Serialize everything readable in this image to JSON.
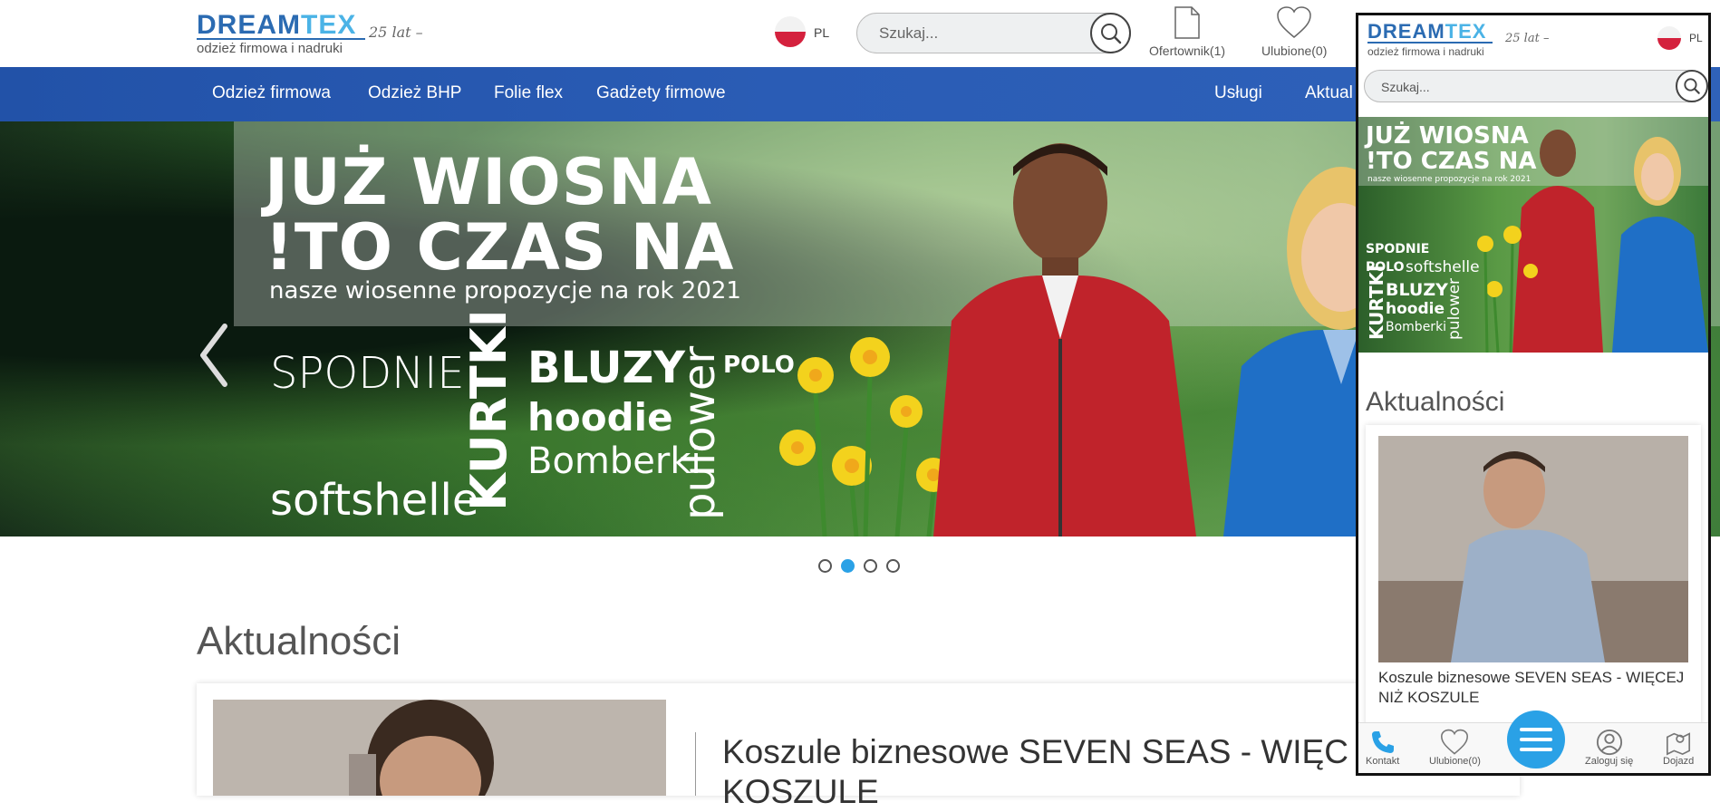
{
  "brand": {
    "logo_word_1": "DREAM",
    "logo_word_2": "TEX",
    "logo_tagline": "odzież firmowa i nadruki",
    "logo_years": "25 lat –"
  },
  "header": {
    "language": "PL",
    "search_placeholder": "Szukaj...",
    "offer_label": "Ofertownik(1)",
    "favorites_label": "Ulubione(0)"
  },
  "nav": {
    "items": [
      "Odzież firmowa",
      "Odzież BHP",
      "Folie flex",
      "Gadżety firmowe"
    ],
    "right_items": [
      "Usługi",
      "Aktual"
    ]
  },
  "hero": {
    "line1": "JUŻ WIOSNA",
    "line2": "!TO CZAS NA",
    "subtitle": "nasze wiosenne propozycje na rok 2021",
    "spodnie": "SPODNIE",
    "softshelle": "softshelle",
    "kurtki": "KURTKI",
    "bluzy": "BLUZY",
    "hoodie": "hoodie",
    "bomberki": "Bomberki",
    "pulower": "pulower",
    "polo": "POLO"
  },
  "carousel": {
    "slide_count": 4,
    "active_index": 1
  },
  "news": {
    "section_title": "Aktualności",
    "headline_line1": "Koszule biznesowe SEVEN SEAS - WIĘC",
    "headline_line2": "KOSZULE"
  },
  "mobile": {
    "language": "PL",
    "search_placeholder": "Szukaj...",
    "hero": {
      "line1": "JUŻ WIOSNA",
      "line2": "!TO CZAS NA",
      "subtitle": "nasze wiosenne propozycje na rok 2021",
      "spodnie": "SPODNIE",
      "polo": "POLO",
      "softshelle": "softshelle",
      "kurtki": "KURTKI",
      "bluzy": "BLUZY",
      "hoodie": "hoodie",
      "bomberki": "Bomberki",
      "pulower": "pulower"
    },
    "section_title": "Aktualności",
    "card_title": "Koszule biznesowe SEVEN SEAS - WIĘCEJ NIŻ KOSZULE",
    "bottom_nav": {
      "contact": "Kontakt",
      "favorites": "Ulubione(0)",
      "login": "Zaloguj się",
      "directions": "Dojazd"
    }
  },
  "colors": {
    "nav_blue": "#2a5cb5",
    "accent_blue": "#2aa1e6",
    "logo_dark": "#2b6bb2",
    "logo_light": "#4bb3e6"
  }
}
